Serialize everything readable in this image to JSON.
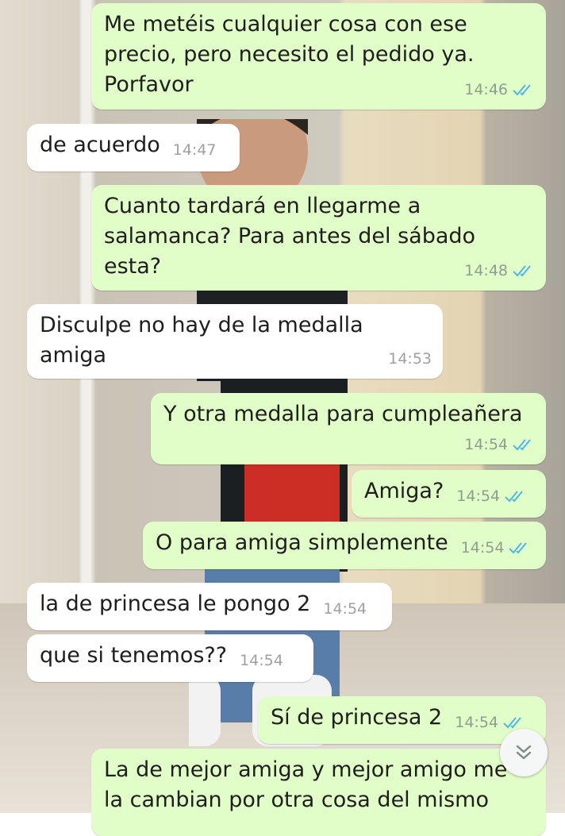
{
  "messages": [
    {
      "dir": "out",
      "text": "Me metéis cualquier cosa con ese\nprecio, pero necesito el pedido ya.\nPorfavor",
      "time": "14:46"
    },
    {
      "dir": "in",
      "text": "de acuerdo",
      "time": "14:47"
    },
    {
      "dir": "out",
      "text": "Cuanto tardará en llegarme a\nsalamanca? Para antes del sábado\nesta?",
      "time": "14:48"
    },
    {
      "dir": "in",
      "text": "Disculpe no hay de la medalla amiga",
      "time": "14:53"
    },
    {
      "dir": "out",
      "text": "Y otra medalla para cumpleañera",
      "time": "14:54"
    },
    {
      "dir": "out",
      "text": "Amiga?",
      "time": "14:54"
    },
    {
      "dir": "out",
      "text": "O para amiga simplemente",
      "time": "14:54"
    },
    {
      "dir": "in",
      "text": "la de princesa le pongo 2",
      "time": "14:54"
    },
    {
      "dir": "in",
      "text": "que si tenemos??",
      "time": "14:54"
    },
    {
      "dir": "out",
      "text": "Sí de princesa 2",
      "time": "14:54"
    },
    {
      "dir": "out",
      "text": "La de mejor amiga y mejor amigo me\nla cambian por otra cosa del mismo",
      "time": ""
    }
  ],
  "colors": {
    "outgoing": "#e2fec8",
    "incoming": "#ffffff",
    "read_ticks": "#4fb6ec"
  },
  "icons": {
    "read_receipt": "double-check-icon",
    "scroll_down": "double-chevron-down-icon"
  }
}
